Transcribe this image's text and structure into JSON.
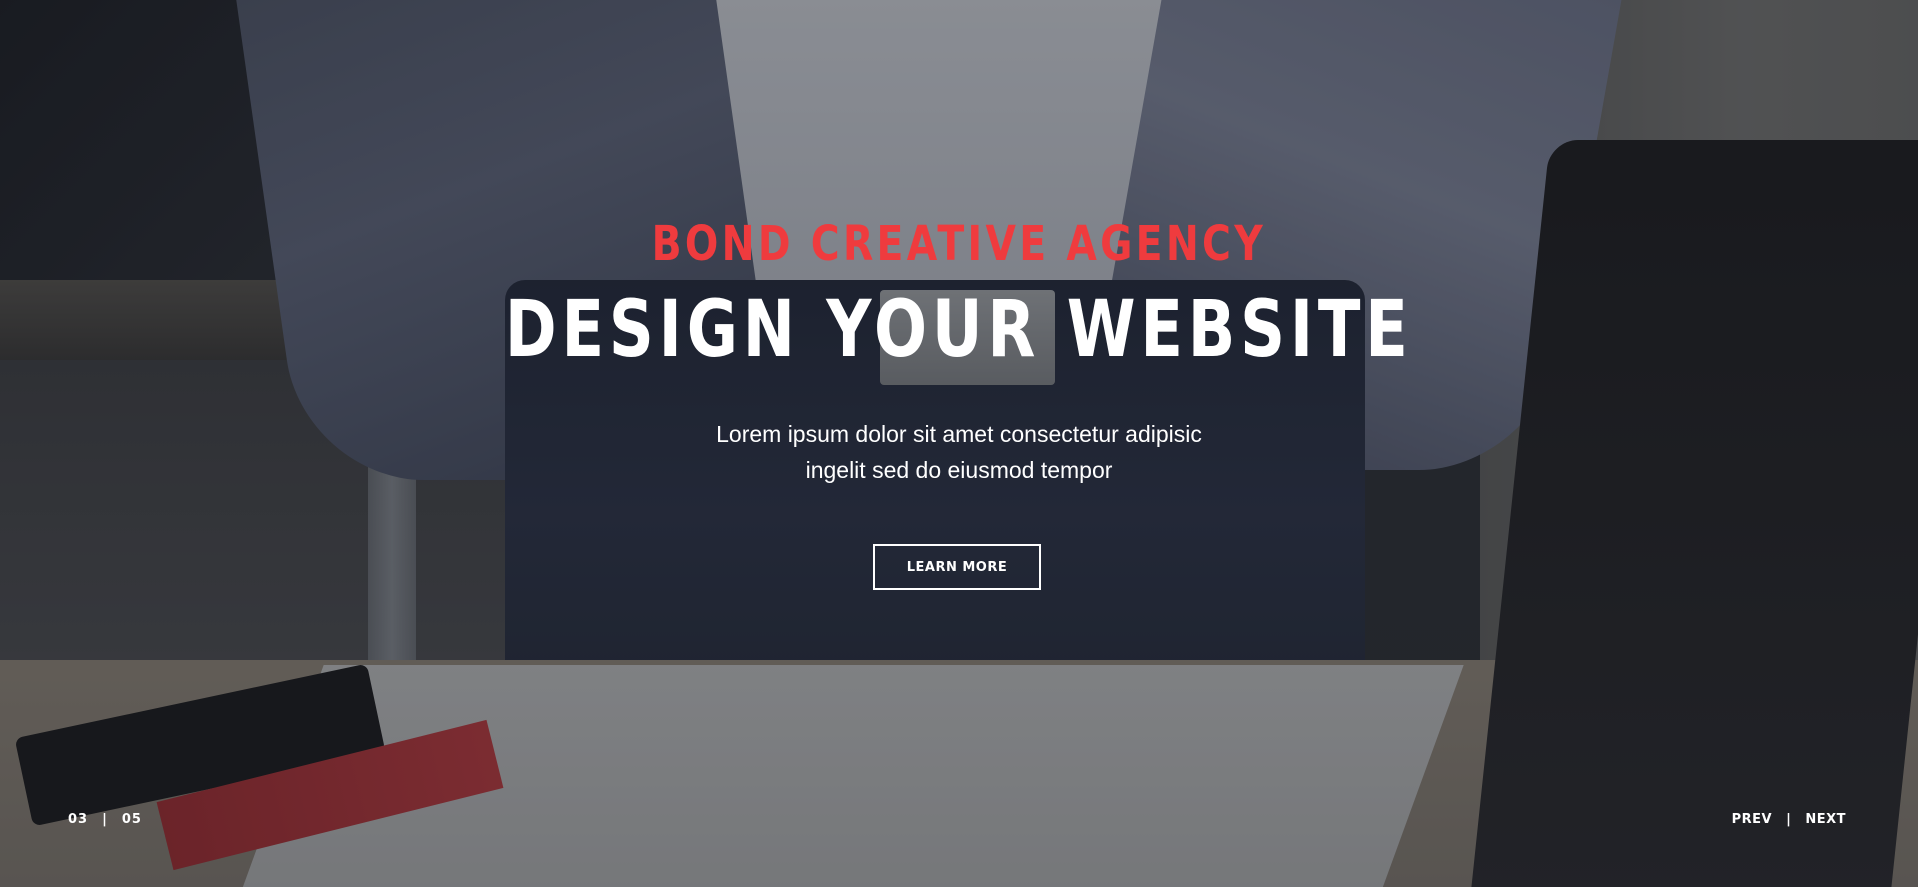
{
  "hero": {
    "kicker": "BOND CREATIVE AGENCY",
    "headline": "DESIGN YOUR WEBSITE",
    "subtext_line1": "Lorem ipsum dolor sit amet consectetur adipisic",
    "subtext_line2": "ingelit sed do eiusmod tempor",
    "cta_label": "LEARN MORE",
    "accent_color": "#ef3b3e"
  },
  "slider": {
    "current": "03",
    "separator": "|",
    "total": "05",
    "prev_label": "PREV",
    "next_label": "NEXT"
  }
}
